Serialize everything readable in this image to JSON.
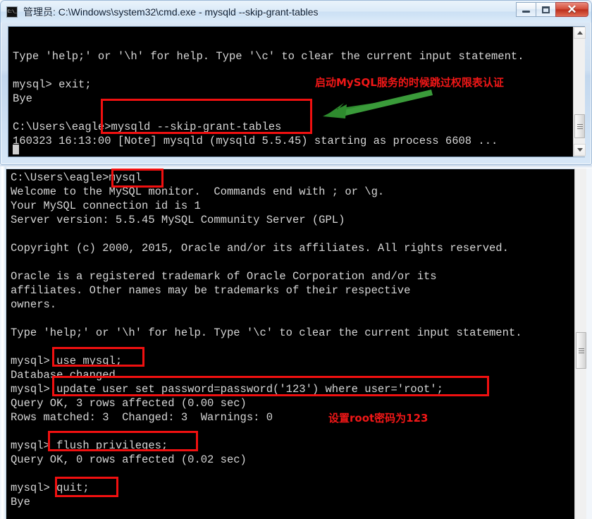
{
  "window": {
    "title": "管理员: C:\\Windows\\system32\\cmd.exe - mysqld  --skip-grant-tables",
    "icon_label": "C:\\_",
    "buttons": {
      "minimize": "Minimize",
      "maximize": "Maximize",
      "close": "✕"
    }
  },
  "top_console": {
    "lines": [
      "",
      "Type 'help;' or '\\h' for help. Type '\\c' to clear the current input statement.",
      "",
      "mysql> exit;",
      "Bye",
      "",
      "C:\\Users\\eagle>mysqld --skip-grant-tables",
      "160323 16:13:00 [Note] mysqld (mysqld 5.5.45) starting as process 6608 ..."
    ]
  },
  "bottom_console": {
    "lines": [
      "C:\\Users\\eagle>mysql",
      "Welcome to the MySQL monitor.  Commands end with ; or \\g.",
      "Your MySQL connection id is 1",
      "Server version: 5.5.45 MySQL Community Server (GPL)",
      "",
      "Copyright (c) 2000, 2015, Oracle and/or its affiliates. All rights reserved.",
      "",
      "Oracle is a registered trademark of Oracle Corporation and/or its",
      "affiliates. Other names may be trademarks of their respective",
      "owners.",
      "",
      "Type 'help;' or '\\h' for help. Type '\\c' to clear the current input statement.",
      "",
      "mysql> use mysql;",
      "Database changed",
      "mysql> update user set password=password('123') where user='root';",
      "Query OK, 3 rows affected (0.00 sec)",
      "Rows matched: 3  Changed: 3  Warnings: 0",
      "",
      "mysql> flush privileges;",
      "Query OK, 0 rows affected (0.02 sec)",
      "",
      "mysql> quit;",
      "Bye"
    ]
  },
  "annotations": {
    "note_skip_grant": "启动MySQL服务的时候跳过权限表认证",
    "note_set_password": "设置root密码为123",
    "box_color": "#f01010",
    "arrow_color": "#2e8b2e"
  },
  "scrollbars": {
    "top": {
      "up": "▲",
      "down": "▼"
    },
    "bottom": {
      "grip": "grip"
    }
  }
}
